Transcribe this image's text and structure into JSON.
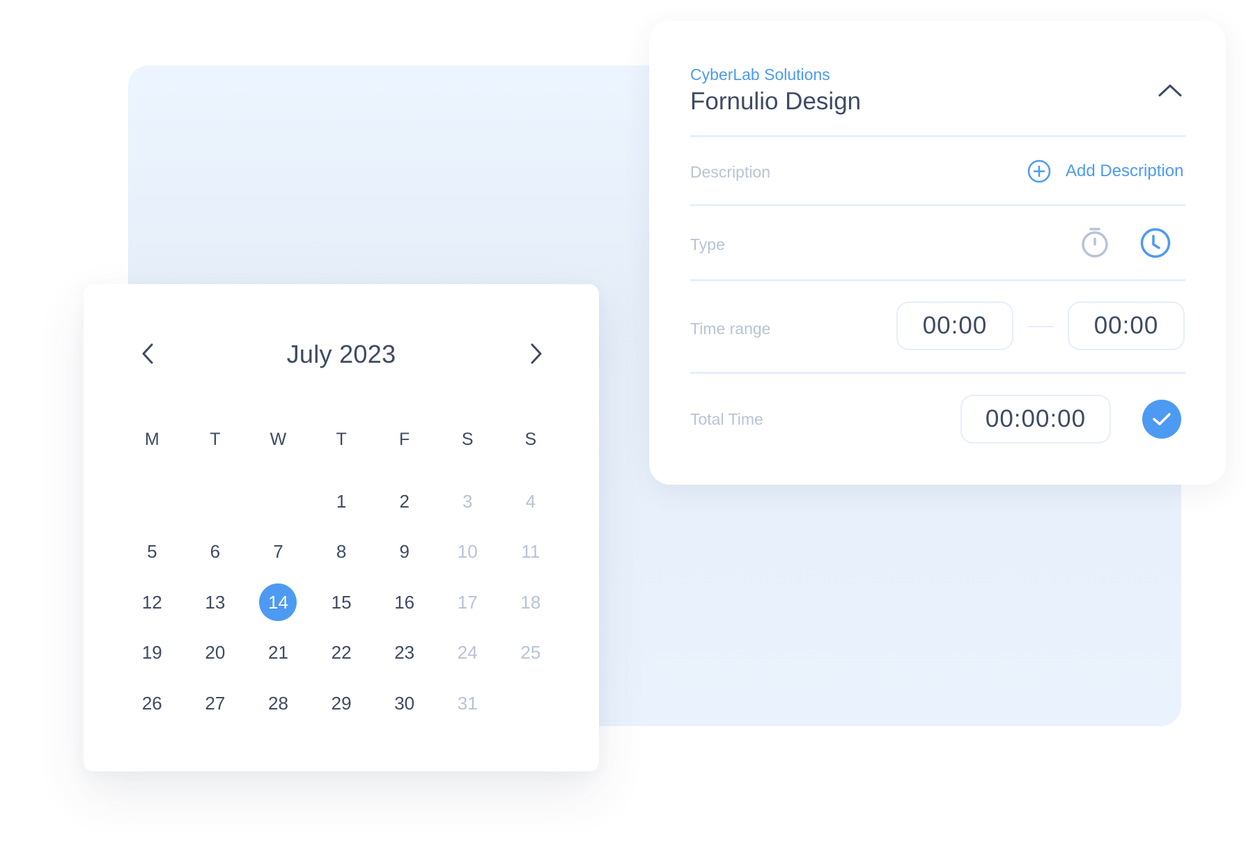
{
  "calendar": {
    "month_label": "July 2023",
    "prev_label": "Previous month",
    "next_label": "Next month",
    "weekdays": [
      "M",
      "T",
      "W",
      "T",
      "F",
      "S",
      "S"
    ],
    "leading_blanks": 3,
    "days": [
      {
        "label": "1",
        "muted": false
      },
      {
        "label": "2",
        "muted": false
      },
      {
        "label": "3",
        "muted": true
      },
      {
        "label": "4",
        "muted": true
      },
      {
        "label": "5",
        "muted": false
      },
      {
        "label": "6",
        "muted": false
      },
      {
        "label": "7",
        "muted": false
      },
      {
        "label": "8",
        "muted": false
      },
      {
        "label": "9",
        "muted": false
      },
      {
        "label": "10",
        "muted": true
      },
      {
        "label": "11",
        "muted": true
      },
      {
        "label": "12",
        "muted": false
      },
      {
        "label": "13",
        "muted": false
      },
      {
        "label": "14",
        "muted": false,
        "selected": true
      },
      {
        "label": "15",
        "muted": false
      },
      {
        "label": "16",
        "muted": false
      },
      {
        "label": "17",
        "muted": true
      },
      {
        "label": "18",
        "muted": true
      },
      {
        "label": "19",
        "muted": false
      },
      {
        "label": "20",
        "muted": false
      },
      {
        "label": "21",
        "muted": false
      },
      {
        "label": "22",
        "muted": false
      },
      {
        "label": "23",
        "muted": false
      },
      {
        "label": "24",
        "muted": true
      },
      {
        "label": "25",
        "muted": true
      },
      {
        "label": "26",
        "muted": false
      },
      {
        "label": "27",
        "muted": false
      },
      {
        "label": "28",
        "muted": false
      },
      {
        "label": "29",
        "muted": false
      },
      {
        "label": "30",
        "muted": false
      },
      {
        "label": "31",
        "muted": true
      }
    ],
    "selected_day": "14"
  },
  "entry": {
    "company": "CyberLab Solutions",
    "project": "Fornulio Design",
    "description_label": "Description",
    "add_description_label": "Add Description",
    "type_label": "Type",
    "type_options": [
      {
        "icon": "stopwatch-icon",
        "active": false
      },
      {
        "icon": "clock-icon",
        "active": true
      }
    ],
    "time_range_label": "Time range",
    "start_time": "00:00",
    "end_time": "00:00",
    "total_time_label": "Total Time",
    "total_time": "00:00:00"
  },
  "colors": {
    "accent": "#4d9af2",
    "text": "#3f4b63",
    "muted": "#b9c3d6",
    "divider": "#e6eefb",
    "panel": "#ecf4fe"
  }
}
